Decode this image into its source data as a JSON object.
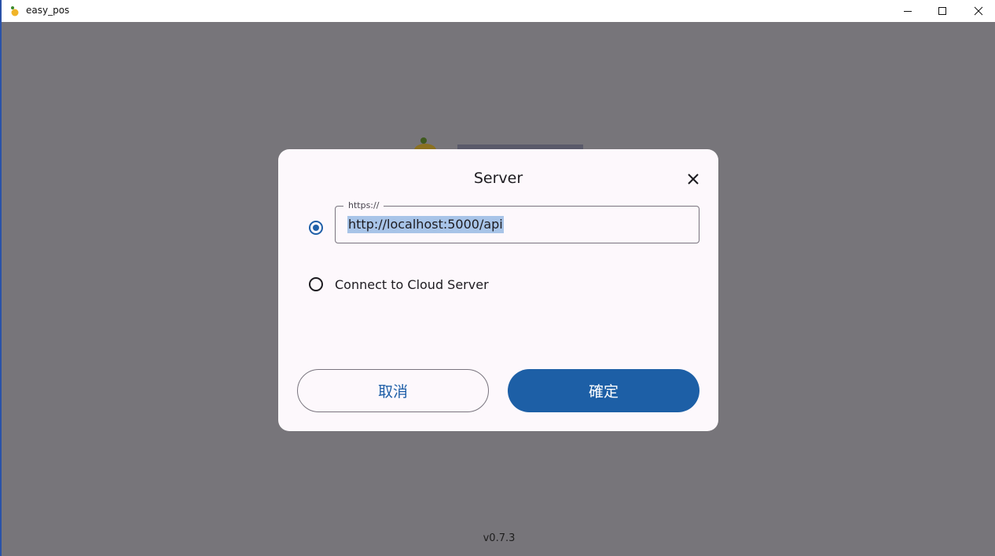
{
  "window": {
    "title": "easy_pos"
  },
  "dialog": {
    "title": "Server",
    "url_field": {
      "label": "https://",
      "value": "http://localhost:5000/api"
    },
    "cloud_option_label": "Connect to Cloud Server",
    "selected_option": "url",
    "cancel_label": "取消",
    "confirm_label": "確定"
  },
  "app": {
    "version": "v0.7.3"
  },
  "colors": {
    "accent": "#1d5fa6",
    "overlay": "#77757a",
    "dialog_bg": "#fdf8fc"
  }
}
